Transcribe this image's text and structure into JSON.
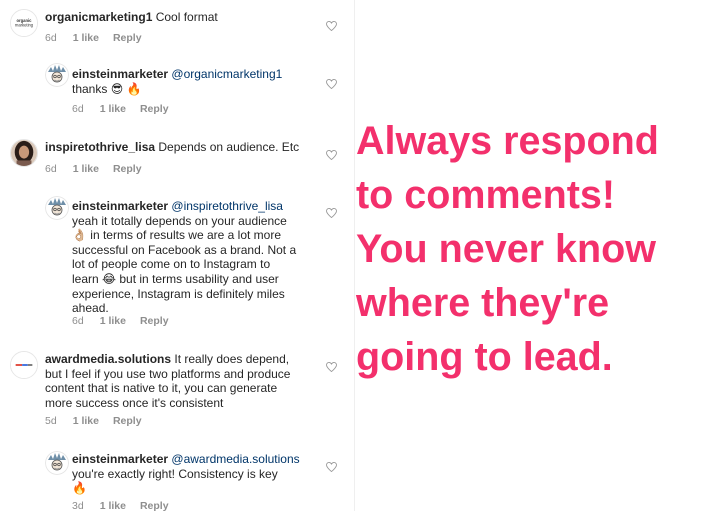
{
  "comments": [
    {
      "user": "organicmarketing1",
      "text": " Cool format",
      "time": "6d",
      "likes": "1 like",
      "reply": "Reply",
      "avatar": "organic-marketing-logo"
    },
    {
      "user": "einsteinmarketer",
      "mention": "@organicmarketing1",
      "text": "thanks 😎 🔥",
      "time": "6d",
      "likes": "1 like",
      "reply": "Reply",
      "avatar": "einstein-avatar"
    },
    {
      "user": "inspiretothrive_lisa",
      "text": " Depends on audience. Etc",
      "time": "6d",
      "likes": "1 like",
      "reply": "Reply",
      "avatar": "lisa-photo"
    },
    {
      "user": "einsteinmarketer",
      "mention": "@inspiretothrive_lisa",
      "lines": [
        "yeah it totally depends on your audience",
        "👌🏼 in terms of results we are a lot more",
        "successful on Facebook as a brand. Not a",
        "lot of people come on to Instagram to",
        "learn 😂 but in terms usability and user",
        "experience, Instagram is definitely miles",
        "ahead."
      ],
      "time": "6d",
      "likes": "1 like",
      "reply": "Reply",
      "avatar": "einstein-avatar"
    },
    {
      "user": "awardmedia.solutions",
      "first_line_rest": " It really does depend,",
      "lines": [
        "but I feel if you use two platforms and produce",
        "content that is native to it, you can generate",
        "more success once it's consistent"
      ],
      "time": "5d",
      "likes": "1 like",
      "reply": "Reply",
      "avatar": "award-media-logo"
    },
    {
      "user": "einsteinmarketer",
      "mention": "@awardmedia.solutions",
      "lines": [
        "you're exactly right! Consistency is key",
        "🔥"
      ],
      "time": "3d",
      "likes": "1 like",
      "reply": "Reply",
      "avatar": "einstein-avatar"
    }
  ],
  "overlay": {
    "lines": [
      "Always respond",
      "to comments!",
      "You never know",
      "where they're",
      "going to lead."
    ],
    "color": "#f3306c"
  },
  "colors": {
    "meta": "#8e8e8e",
    "text": "#262626",
    "mention": "#003569"
  }
}
